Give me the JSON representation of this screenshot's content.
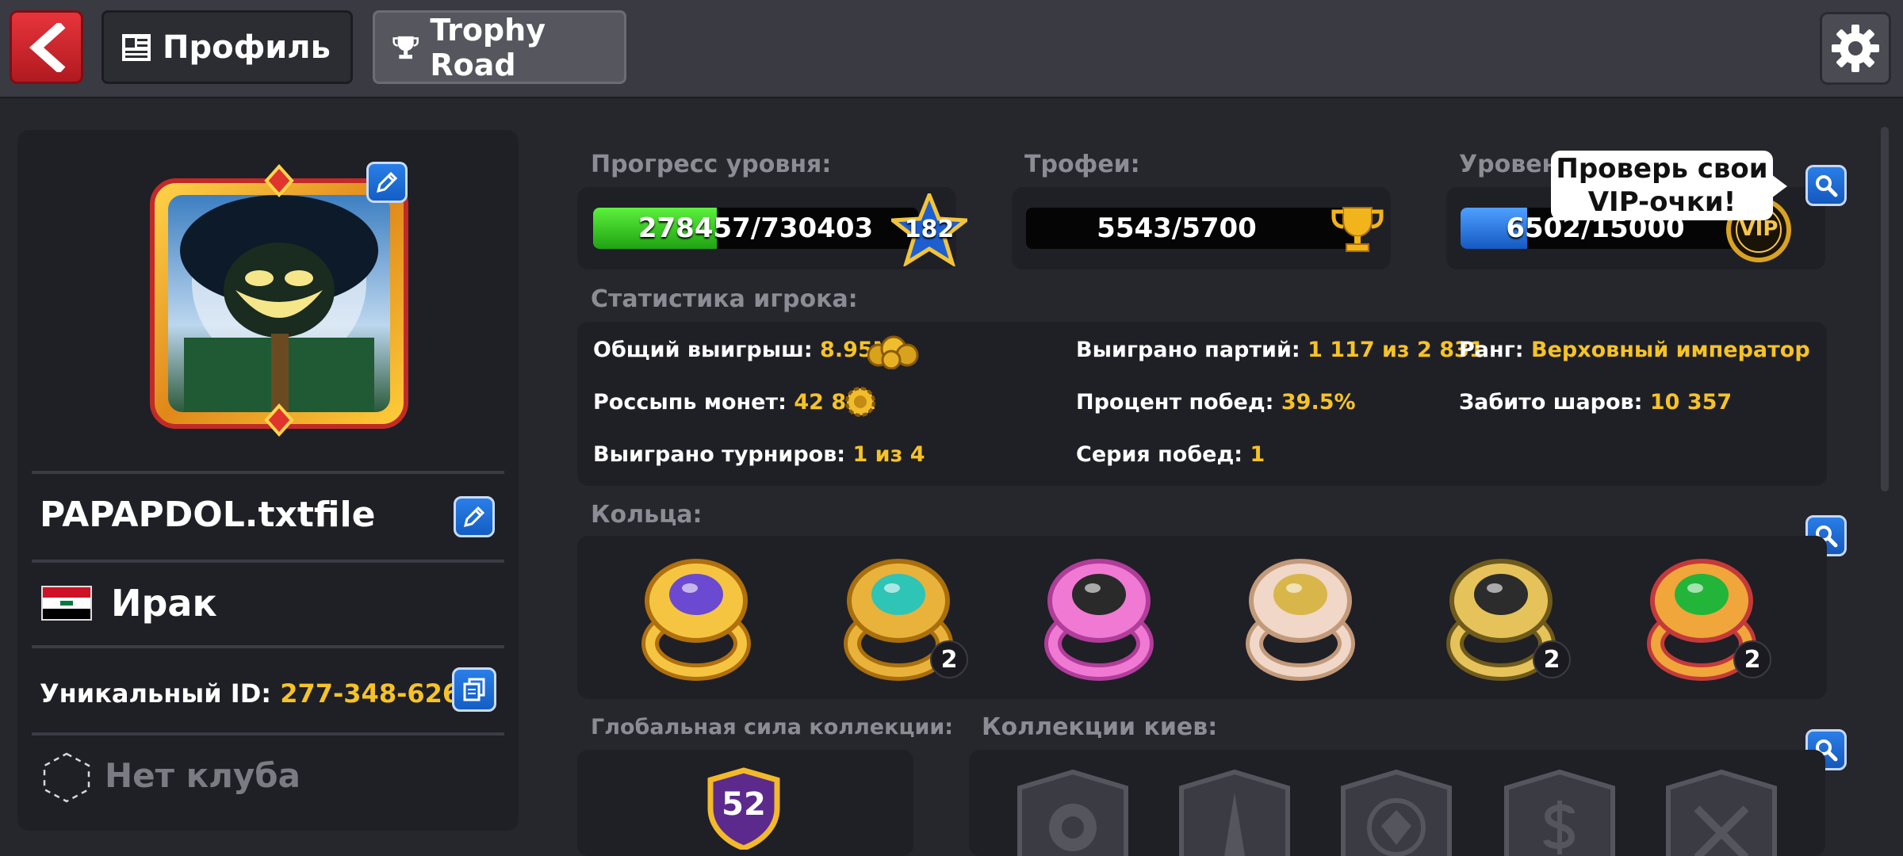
{
  "header": {
    "tabs": [
      {
        "label": "Профиль"
      },
      {
        "label": "Trophy Road"
      }
    ]
  },
  "profile": {
    "name": "PAPAPDOL.txtfile",
    "country": "Ирак",
    "uid_label": "Уникальный ID:",
    "uid_value": "277-348-626-9",
    "club": "Нет клуба"
  },
  "progress": {
    "level_label": "Прогресс уровня:",
    "level_value": "278457/730403",
    "level_fraction": 0.381,
    "level_number": "182",
    "trophy_label": "Трофеи:",
    "trophy_value": "5543/5700",
    "vip_label": "Уровень",
    "vip_value": "6502/15000",
    "vip_fraction": 0.21,
    "vip_badge": "VIP",
    "tooltip": "Проверь свои VIP-очки!"
  },
  "stats": {
    "title": "Статистика игрока:",
    "total_win_label": "Общий выигрыш:",
    "total_win_value": "8.95M",
    "coins_label": "Россыпь монет:",
    "coins_value": "42 851",
    "tournaments_label": "Выиграно турниров:",
    "tournaments_value": "1 из 4",
    "games_label": "Выиграно партий:",
    "games_value": "1 117 из 2 831",
    "winrate_label": "Процент побед:",
    "winrate_value": "39.5%",
    "streak_label": "Серия побед:",
    "streak_value": "1",
    "rank_label": "Ранг:",
    "rank_value": "Верховный император",
    "balls_label": "Забито шаров:",
    "balls_value": "10 357"
  },
  "rings": {
    "title": "Кольца:",
    "items": [
      {
        "badge": ""
      },
      {
        "badge": "2"
      },
      {
        "badge": ""
      },
      {
        "badge": ""
      },
      {
        "badge": "2"
      },
      {
        "badge": "2"
      }
    ]
  },
  "collection": {
    "power_label": "Глобальная сила коллекции:",
    "power_value": "52",
    "cues_label": "Коллекции киев:"
  },
  "colors": {
    "accent_yellow": "#f6c326",
    "level_bar": "#2fd11b",
    "vip_bar": "#1f7ae0",
    "back_red": "#d8262d"
  }
}
